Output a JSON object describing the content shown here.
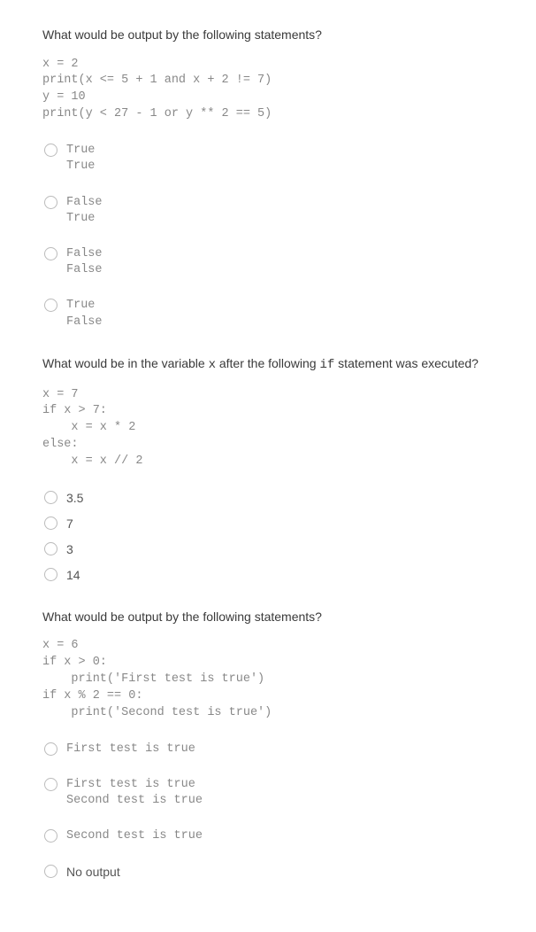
{
  "questions": [
    {
      "prompt": "What would be output by the following statements?",
      "code": "x = 2\nprint(x <= 5 + 1 and x + 2 != 7)\ny = 10\nprint(y < 27 - 1 or y ** 2 == 5)",
      "options": [
        {
          "label": "True\nTrue",
          "mono": true
        },
        {
          "label": "False\nTrue",
          "mono": true
        },
        {
          "label": "False\nFalse",
          "mono": true
        },
        {
          "label": "True\nFalse",
          "mono": true
        }
      ],
      "tight": false
    },
    {
      "prompt_parts": [
        "What would be in the variable ",
        "x",
        " after the following ",
        "if",
        " statement was executed?"
      ],
      "code": "x = 7\nif x > 7:\n    x = x * 2\nelse:\n    x = x // 2",
      "options": [
        {
          "label": "3.5",
          "mono": false
        },
        {
          "label": "7",
          "mono": false
        },
        {
          "label": "3",
          "mono": false
        },
        {
          "label": "14",
          "mono": false
        }
      ],
      "tight": true
    },
    {
      "prompt": "What would be output by the following statements?",
      "code": "x = 6\nif x > 0:\n    print('First test is true')\nif x % 2 == 0:\n    print('Second test is true')",
      "options": [
        {
          "label": "First test is true",
          "mono": true
        },
        {
          "label": "First test is true\nSecond test is true",
          "mono": true
        },
        {
          "label": "Second test is true",
          "mono": true
        },
        {
          "label": "No output",
          "mono": false
        }
      ],
      "tight": false
    }
  ]
}
